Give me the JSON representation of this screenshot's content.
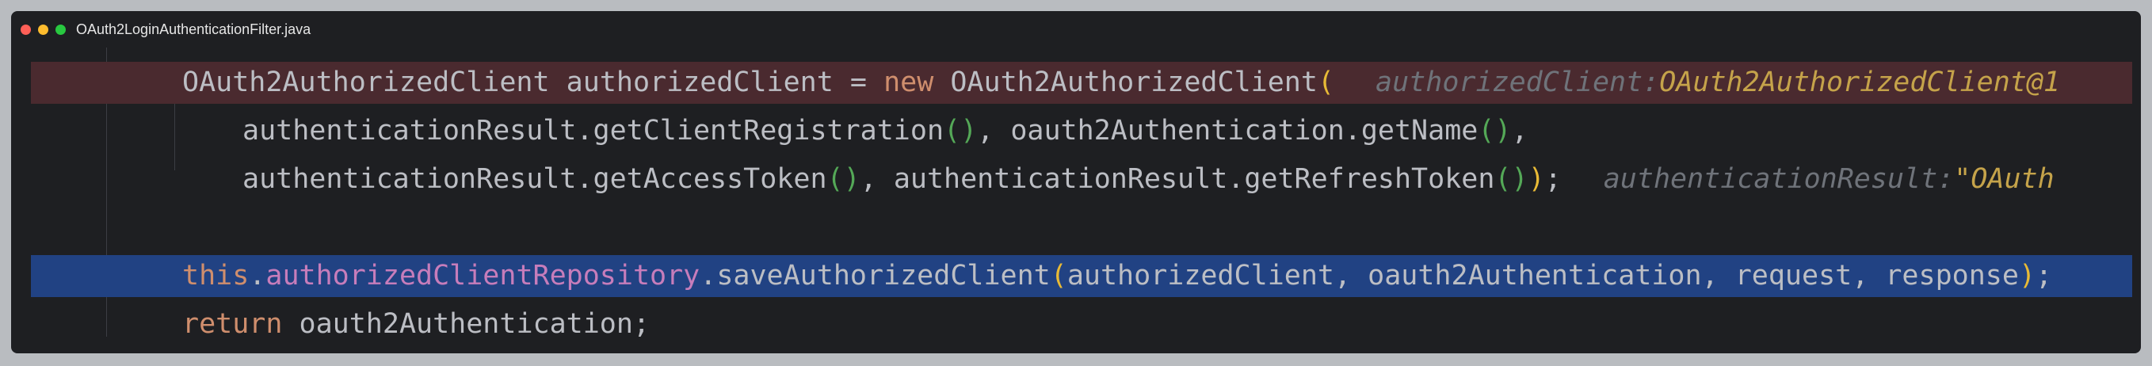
{
  "window": {
    "title": "OAuth2LoginAuthenticationFilter.java"
  },
  "code": {
    "line1": {
      "type": "OAuth2AuthorizedClient",
      "var": "authorizedClient",
      "eq": "=",
      "new_kw": "new",
      "ctor": "OAuth2AuthorizedClient",
      "open_paren": "(",
      "hint_label": "authorizedClient:",
      "hint_value": "OAuth2AuthorizedClient@1"
    },
    "line2": {
      "a": "authenticationResult.getClientRegistration",
      "a_parens": "()",
      "sep": ", ",
      "b": "oauth2Authentication.getName",
      "b_parens": "()",
      "tail": ","
    },
    "line3": {
      "a": "authenticationResult.getAccessToken",
      "a_parens": "()",
      "sep": ", ",
      "b": "authenticationResult.getRefreshToken",
      "b_parens": "()",
      "close_paren": ")",
      "tail": ";",
      "hint_label": "authenticationResult:",
      "hint_value": "\"OAuth"
    },
    "line5": {
      "this_kw": "this",
      "dot": ".",
      "field": "authorizedClientRepository",
      "method": ".saveAuthorizedClient",
      "open_paren": "(",
      "args": "authorizedClient, oauth2Authentication, request, response",
      "close_paren": ")",
      "tail": ";"
    },
    "line6": {
      "return_kw": "return",
      "value": "oauth2Authentication;"
    }
  },
  "colors": {
    "editor_bg": "#1e1f22",
    "breakpoint_line": "#4a2a2f",
    "selected_line": "#214283",
    "keyword": "#cf8e6d",
    "field": "#c77dbb"
  }
}
